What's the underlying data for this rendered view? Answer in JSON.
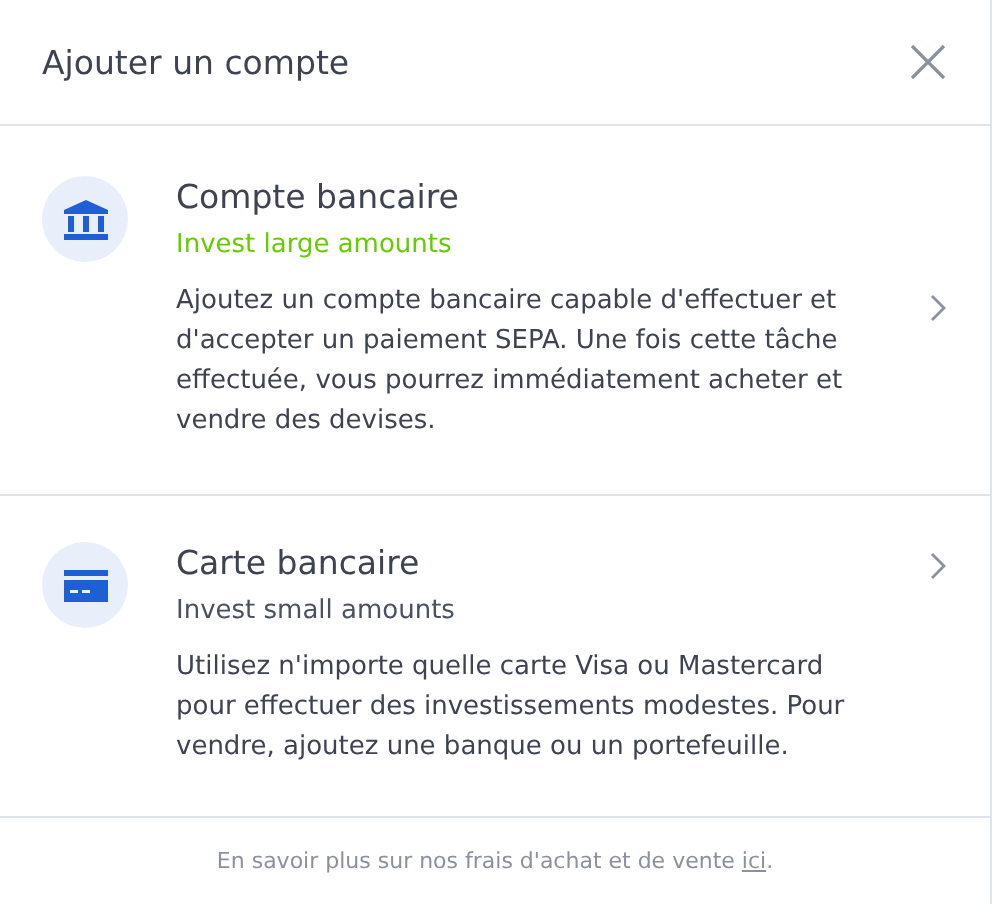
{
  "dialog": {
    "title": "Ajouter un compte"
  },
  "options": [
    {
      "kind": "bank",
      "title": "Compte bancaire",
      "subtitle": "Invest large amounts",
      "color": "#66cc00",
      "description": "Ajoutez un compte bancaire capable d'effectuer et d'accepter un paiement SEPA. Une fois cette tâche effectuée, vous pourrez immédiatement acheter et vendre des devises."
    },
    {
      "kind": "card",
      "title": "Carte bancaire",
      "subtitle": "Invest small amounts",
      "color": "#4a5160",
      "description": "Utilisez n'importe quelle carte Visa ou Mastercard pour effectuer des investissements modestes. Pour vendre, ajoutez une banque ou un portefeuille."
    }
  ],
  "footer": {
    "text": "En savoir plus sur nos frais d'achat et de vente",
    "link": "ici",
    "end": "."
  }
}
